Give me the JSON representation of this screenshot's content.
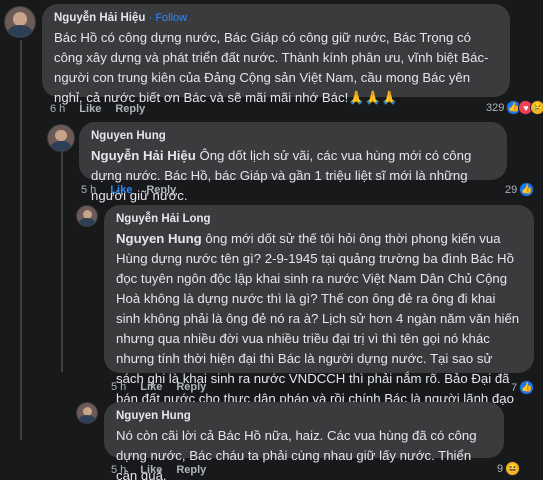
{
  "comments": [
    {
      "author": "Nguyễn Hải Hiệu",
      "follow_label": "· Follow",
      "text": "Bác Hồ có công dựng nước, Bác Giáp có công giữ nước, Bác Trọng có công xây dựng và phát triển đất nước. Thành kính phân ưu, vĩnh biệt Bác- người con trung kiên của Đảng Cộng sản Việt Nam, cầu mong Bác yên nghỉ, cả nước biết ơn Bác và sẽ mãi mãi nhớ Bác!🙏🙏🙏",
      "time": "6 h",
      "like_label": "Like",
      "reply_label": "Reply",
      "reaction_count": "329",
      "reactions": [
        "like-icon",
        "love-icon",
        "sad-icon"
      ]
    },
    {
      "author": "Nguyen Hung",
      "mention": "Nguyễn Hải Hiệu",
      "text": " Ông dốt lịch sử vãi, các vua hùng mới có công dựng nước. Bác Hồ, bác Giáp và gần 1 triệu liệt sĩ mới là những người giữ nước.",
      "time": "5 h",
      "like_label": "Like",
      "reply_label": "Reply",
      "reaction_count": "29",
      "reactions": [
        "like-icon"
      ]
    },
    {
      "author": "Nguyễn Hải Long",
      "mention": "Nguyen Hung",
      "text": " ông mới dốt sử thế tôi hỏi ông thời phong kiến vua Hùng dựng nước tên gì? 2-9-1945 tại quảng trường ba đình Bác Hồ đọc tuyên ngôn độc lập khai sinh ra nước Việt Nam Dân Chủ Cộng Hoà không là dựng nước thì là gì? Thế con ông đẻ ra ông đi khai sinh không phải là ông đẻ nó ra à? Lịch sử hơn 4 ngàn năm văn hiến nhưng qua nhiều đời vua nhiều triều đại trị vì thì tên gọi nó khác nhưng tính thời hiện đại thì Bác là người dựng nước. Tại sao sử sách ghi là khai sinh ra nước VNDCCH thì phải nắm rõ. Bảo Đại đã bán đất nước cho thực dân pháp và rồi chính Bác là người lãnh đạo đánh đuổi pháp để khai sinh ra nước VNDCCH",
      "time": "5 h",
      "like_label": "Like",
      "reply_label": "Reply",
      "reaction_count": "7",
      "reactions": [
        "like-icon"
      ]
    },
    {
      "author": "Nguyen Hung",
      "text": "Nó còn cãi lời cả Bác Hồ nữa, haiz. Các vua hùng đã có công dựng nước, Bác cháu ta phải cùng nhau giữ lấy nước. Thiển cận quá.",
      "time": "5 h",
      "like_label": "Like",
      "reply_label": "Reply",
      "reaction_count": "9",
      "reactions": [
        "haha-icon"
      ]
    }
  ],
  "colors": {
    "background": "#18191a",
    "bubble": "#3a3b3c",
    "link_blue": "#2d88ff",
    "meta_gray": "#b0b3b8"
  }
}
